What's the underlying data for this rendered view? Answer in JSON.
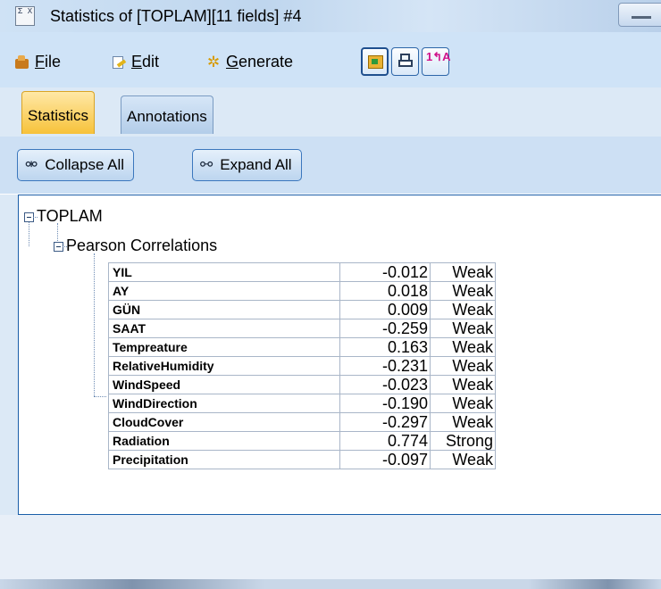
{
  "window": {
    "app_icon_text": "Σ X",
    "title": "Statistics of [TOPLAM][11 fields] #4"
  },
  "menu": {
    "file": {
      "u": "F",
      "rest": "ile"
    },
    "edit": {
      "u": "E",
      "rest": "dit"
    },
    "generate": {
      "u": "G",
      "rest": "enerate"
    },
    "toolbar_icons": [
      "copy-to-clipboard-icon",
      "print-icon",
      "sort-icon"
    ]
  },
  "tabs": [
    {
      "label": "Statistics",
      "active": true
    },
    {
      "label": "Annotations",
      "active": false
    }
  ],
  "actions": {
    "collapse_label": "Collapse All",
    "expand_label": "Expand All"
  },
  "tree": {
    "root_label": "TOPLAM",
    "child_label": "Pearson Correlations"
  },
  "correlations": [
    {
      "field": "YIL",
      "value": "-0.012",
      "strength": "Weak"
    },
    {
      "field": "AY",
      "value": "0.018",
      "strength": "Weak"
    },
    {
      "field": "GÜN",
      "value": "0.009",
      "strength": "Weak"
    },
    {
      "field": "SAAT",
      "value": "-0.259",
      "strength": "Weak"
    },
    {
      "field": "Tempreature",
      "value": "0.163",
      "strength": "Weak"
    },
    {
      "field": "RelativeHumidity",
      "value": "-0.231",
      "strength": "Weak"
    },
    {
      "field": "WindSpeed",
      "value": "-0.023",
      "strength": "Weak"
    },
    {
      "field": "WindDirection",
      "value": "-0.190",
      "strength": "Weak"
    },
    {
      "field": "CloudCover",
      "value": "-0.297",
      "strength": "Weak"
    },
    {
      "field": "Radiation",
      "value": "0.774",
      "strength": "Strong"
    },
    {
      "field": "Precipitation",
      "value": "-0.097",
      "strength": "Weak"
    }
  ]
}
